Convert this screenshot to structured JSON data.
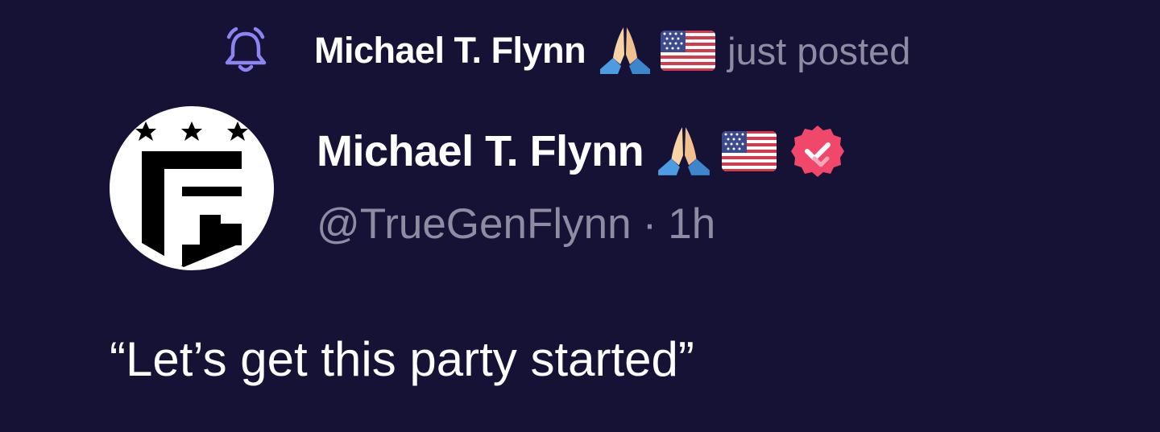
{
  "notification": {
    "icon": "bell-icon",
    "name": "Michael T. Flynn",
    "emoji_1": "folded-hands",
    "emoji_2": "us-flag",
    "action": "just posted"
  },
  "post": {
    "author": {
      "avatar_logo": "G-shield-three-stars",
      "name": "Michael T. Flynn",
      "emoji_1": "folded-hands",
      "emoji_2": "us-flag",
      "verified_icon": "verified-badge-icon",
      "handle": "@TrueGenFlynn",
      "separator": "·",
      "time": "1h"
    },
    "text": "“Let’s get this party started”"
  },
  "colors": {
    "background": "#161235",
    "accent": "#8C84F0",
    "verified": "#F0476B",
    "muted": "#8E8BA3"
  }
}
